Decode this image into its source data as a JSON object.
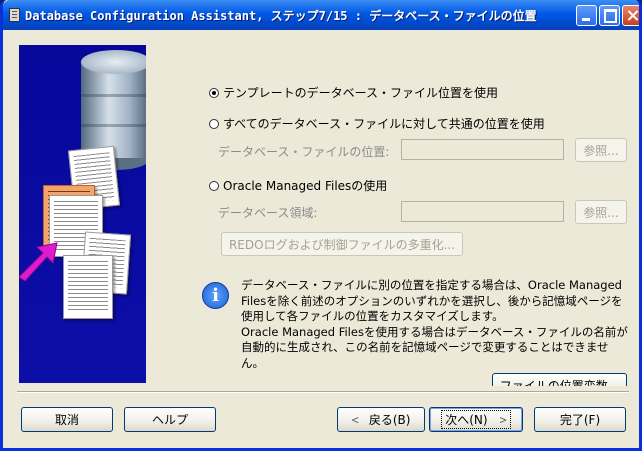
{
  "window": {
    "title": "Database Configuration Assistant, ステップ7/15 : データベース・ファイルの位置"
  },
  "options": {
    "template_label": "テンプレートのデータベース・ファイル位置を使用",
    "common_label": "すべてのデータベース・ファイルに対して共通の位置を使用",
    "common_field_label": "データベース・ファイルの位置:",
    "common_field_value": "",
    "common_browse": "参照...",
    "omf_label": "Oracle Managed Filesの使用",
    "omf_field_label": "データベース領域:",
    "omf_field_value": "",
    "omf_browse": "参照...",
    "multiplex_button": "REDOログおよび制御ファイルの多重化...",
    "selected": "template"
  },
  "info": {
    "para1": "データベース・ファイルに別の位置を指定する場合は、Oracle Managed Filesを除く前述のオプションのいずれかを選択し、後から記憶域ページを使用して各ファイルの位置をカスタマイズします。",
    "para2": "Oracle Managed Filesを使用する場合はデータベース・ファイルの名前が自動的に生成され、この名前を記憶域ページで変更することはできません。",
    "file_location_button": "ファイルの位置変数..."
  },
  "footer": {
    "cancel": "取消",
    "help": "ヘルプ",
    "back": "戻る(B)",
    "next": "次へ(N)",
    "finish": "完了(F)"
  },
  "colors": {
    "titlebar": "#0058e6",
    "panel_bg": "#ece9d8",
    "art_bg": "#06089a",
    "info_icon": "#1b5fd6"
  }
}
